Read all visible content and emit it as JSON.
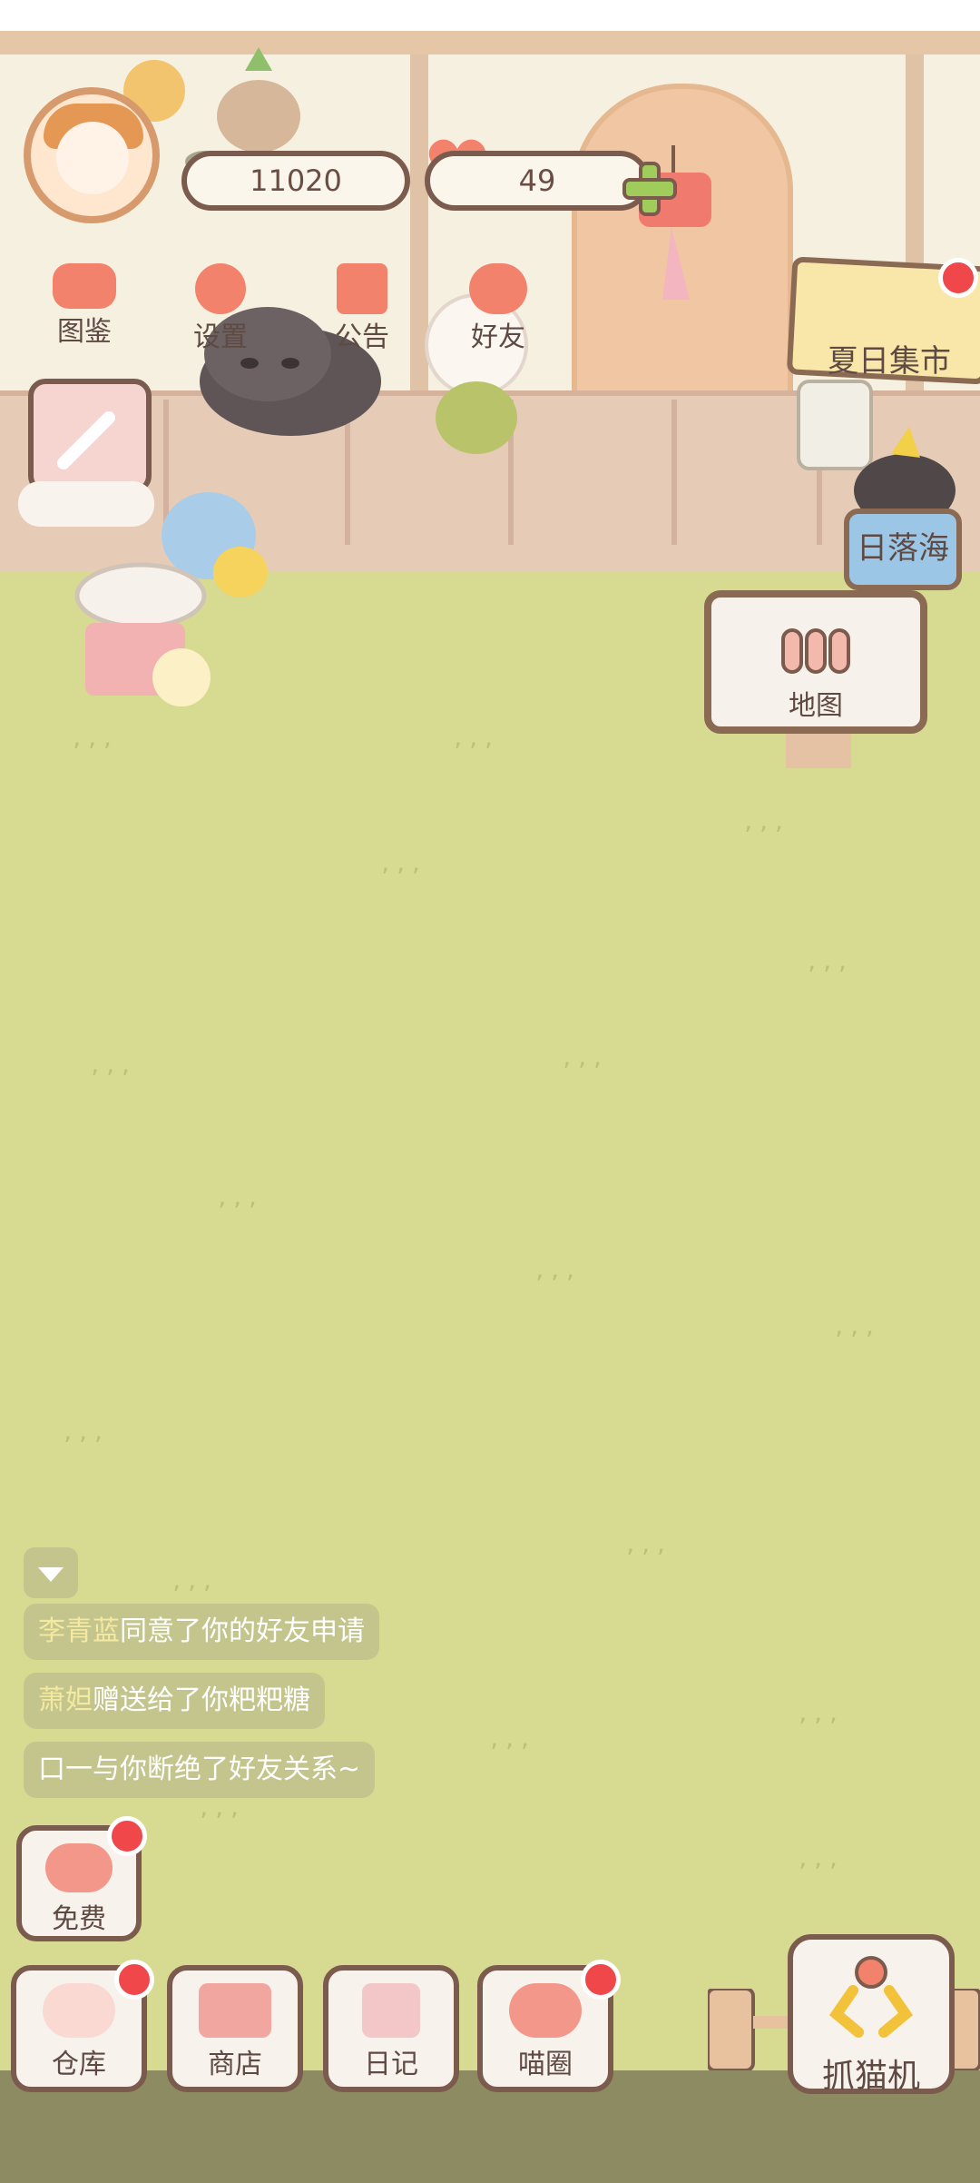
{
  "hud": {
    "fish_count": "11020",
    "heart_count": "49"
  },
  "top_menu": [
    {
      "label": "图鉴",
      "icon": "cat-head-icon"
    },
    {
      "label": "设置",
      "icon": "gear-icon"
    },
    {
      "label": "公告",
      "icon": "gift-icon"
    },
    {
      "label": "好友",
      "icon": "friends-icon"
    }
  ],
  "places": {
    "summer_market": "夏日集市",
    "sunset_sea": "日落海",
    "map": "地图"
  },
  "messages": [
    {
      "name": "李青蓝",
      "text": "同意了你的好友申请"
    },
    {
      "name": "萧妲",
      "text": "赠送给了你粑粑糖"
    },
    {
      "name": "",
      "text": "口一与你断绝了好友关系~"
    }
  ],
  "free_button": {
    "label": "免费",
    "badge": true
  },
  "bottom_bar": [
    {
      "label": "仓库",
      "badge": true,
      "color": "#f9d9d2"
    },
    {
      "label": "商店",
      "badge": false,
      "color": "#f2a6a0"
    },
    {
      "label": "日记",
      "badge": false,
      "color": "#f3c6c8"
    },
    {
      "label": "喵圈",
      "badge": true,
      "color": "#f2978a"
    }
  ],
  "claw_machine": {
    "label": "抓猫机"
  },
  "colors": {
    "grass": "#d7da91",
    "accent_red": "#f0474b",
    "icon_coral": "#f2826b",
    "border_brown": "#7b5b4e"
  }
}
